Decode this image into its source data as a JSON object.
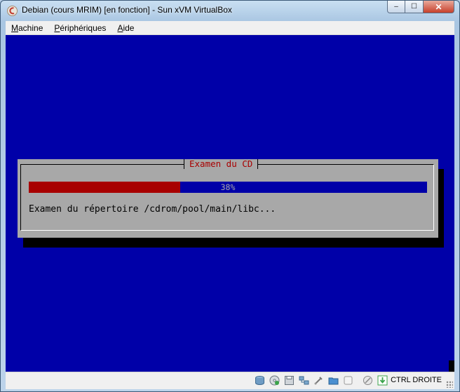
{
  "window": {
    "title": "Debian (cours MRIM) [en fonction] - Sun xVM VirtualBox",
    "controls": {
      "minimize": "–",
      "maximize": "☐",
      "close": "✕"
    }
  },
  "menubar": {
    "items": [
      {
        "label": "Machine"
      },
      {
        "label": "Périphériques"
      },
      {
        "label": "Aide"
      }
    ]
  },
  "installer": {
    "dialog_title": "Examen du CD",
    "progress_percent": 38,
    "progress_label": "38%",
    "status": "Examen du répertoire /cdrom/pool/main/libc..."
  },
  "colors": {
    "screen_bg": "#0000a8",
    "dialog_bg": "#a8a8a8",
    "progress_fill": "#a80000",
    "title_text": "#a80000"
  },
  "statusbar": {
    "icons": [
      "hard-disk-icon",
      "cd-icon",
      "floppy-icon",
      "network-icon",
      "usb-icon",
      "shared-folder-icon",
      "vrdp-icon",
      "mouse-integration-icon",
      "host-key-icon"
    ],
    "host_key_label": "CTRL DROITE"
  }
}
